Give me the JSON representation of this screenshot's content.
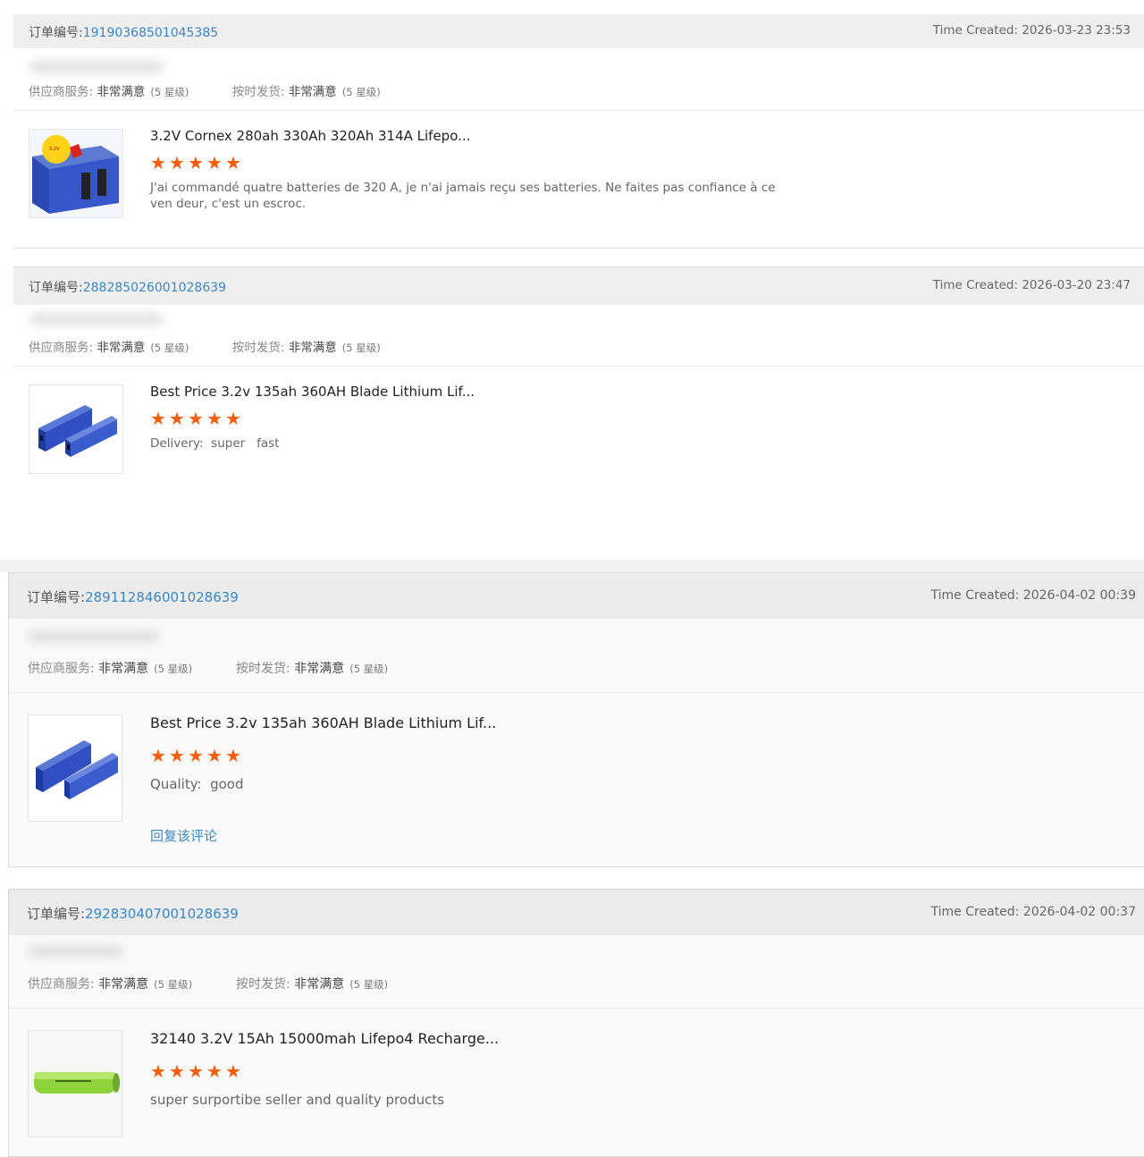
{
  "labels": {
    "order_no": "订单编号:",
    "time_created": "Time Created:",
    "supplier_service": "供应商服务:",
    "on_time_shipping": "按时发货:",
    "very_satisfied": "非常满意",
    "five_star": "(5 星级)"
  },
  "orders": [
    {
      "order_id": "19190368501045385",
      "time": "2026-03-23 23:53",
      "title": "3.2V Cornex 280ah 330Ah 320Ah 314A Lifepo...",
      "rating": 5,
      "comment": "J'ai commandé quatre batteries de 320 A, je n'ai jamais reçu ses batteries. Ne faites pas confiance à ce ven deur, c'est un escroc.",
      "thumb_icon": "blue-battery-cell-icon"
    },
    {
      "order_id": "288285026001028639",
      "time": "2026-03-20 23:47",
      "title": "Best Price 3.2v 135ah 360AH Blade Lithium Lif...",
      "rating": 5,
      "comment": "Delivery:  super   fast",
      "thumb_icon": "blade-battery-icon"
    },
    {
      "order_id": "289112846001028639",
      "time": "2026-04-02 00:39",
      "title": "Best Price 3.2v 135ah 360AH Blade Lithium Lif...",
      "rating": 5,
      "comment": "Quality:  good",
      "reply": "回复该评论",
      "thumb_icon": "blade-battery-icon"
    },
    {
      "order_id": "292830407001028639",
      "time": "2026-04-02 00:37",
      "title": "32140 3.2V 15Ah 15000mah Lifepo4 Recharge...",
      "rating": 5,
      "comment": "super surportibe seller and quality products",
      "thumb_icon": "cylindrical-cell-icon"
    }
  ],
  "colors": {
    "link": "#3a86c8",
    "star": "#f25e0d",
    "header_bg": "#efefef"
  }
}
